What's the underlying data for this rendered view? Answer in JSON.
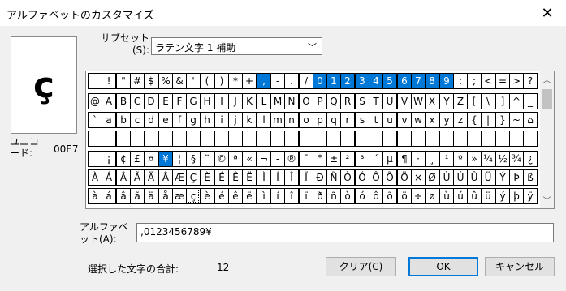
{
  "window": {
    "title": "アルファベットのカスタマイズ",
    "close_glyph": "✕"
  },
  "preview": {
    "char": "ç",
    "unicode_label": "ユニコード:",
    "unicode_value": "00E7"
  },
  "subset": {
    "label": "サブセット(S):",
    "value": "ラテン文字 1 補助",
    "arrow": "﹀"
  },
  "grid": {
    "rows": [
      [
        " ",
        "!",
        "\"",
        "#",
        "$",
        "%",
        "&",
        "'",
        "(",
        ")",
        "*",
        "+",
        ",",
        "-",
        ".",
        "/",
        "0",
        "1",
        "2",
        "3",
        "4",
        "5",
        "6",
        "7",
        "8",
        "9",
        ":",
        ";",
        "<",
        "=",
        ">",
        "?"
      ],
      [
        "@",
        "A",
        "B",
        "C",
        "D",
        "E",
        "F",
        "G",
        "H",
        "I",
        "J",
        "K",
        "L",
        "M",
        "N",
        "O",
        "P",
        "Q",
        "R",
        "S",
        "T",
        "U",
        "V",
        "W",
        "X",
        "Y",
        "Z",
        "[",
        "\\",
        "]",
        "^",
        "_"
      ],
      [
        "`",
        "a",
        "b",
        "c",
        "d",
        "e",
        "f",
        "g",
        "h",
        "i",
        "j",
        "k",
        "l",
        "m",
        "n",
        "o",
        "p",
        "q",
        "r",
        "s",
        "t",
        "u",
        "v",
        "w",
        "x",
        "y",
        "z",
        "{",
        "|",
        "}",
        "~",
        "⌂"
      ],
      [
        "",
        "",
        "",
        "",
        "",
        "",
        "",
        "",
        "",
        "",
        "",
        "",
        "",
        "",
        "",
        "",
        "",
        "",
        "",
        "",
        "",
        "",
        "",
        "",
        "",
        "",
        "",
        "",
        "",
        "",
        "",
        ""
      ],
      [
        " ",
        "¡",
        "¢",
        "£",
        "¤",
        "¥",
        "¦",
        "§",
        "¨",
        "©",
        "ª",
        "«",
        "¬",
        "-",
        "®",
        "¯",
        "°",
        "±",
        "²",
        "³",
        "´",
        "µ",
        "¶",
        "·",
        "¸",
        "¹",
        "º",
        "»",
        "¼",
        "½",
        "¾",
        "¿"
      ],
      [
        "À",
        "Á",
        "Â",
        "Ã",
        "Ä",
        "Å",
        "Æ",
        "Ç",
        "È",
        "É",
        "Ê",
        "Ë",
        "Ì",
        "Í",
        "Î",
        "Ï",
        "Ð",
        "Ñ",
        "Ò",
        "Ó",
        "Ô",
        "Õ",
        "Ö",
        "×",
        "Ø",
        "Ù",
        "Ú",
        "Û",
        "Ü",
        "Ý",
        "Þ",
        "ß"
      ],
      [
        "à",
        "á",
        "â",
        "ã",
        "ä",
        "å",
        "æ",
        "ç",
        "è",
        "é",
        "ê",
        "ë",
        "ì",
        "í",
        "î",
        "ï",
        "ð",
        "ñ",
        "ò",
        "ó",
        "ô",
        "õ",
        "ö",
        "÷",
        "ø",
        "ù",
        "ú",
        "û",
        "ü",
        "ý",
        "þ",
        "ÿ"
      ]
    ],
    "selected": [
      "0-12",
      "0-16",
      "0-17",
      "0-18",
      "0-19",
      "0-20",
      "0-21",
      "0-22",
      "0-23",
      "0-24",
      "0-25",
      "4-5"
    ],
    "focused": "6-7",
    "scroll_up": "︿",
    "scroll_down": "﹀"
  },
  "alphabet": {
    "label": "アルファベット(A):",
    "value": ",0123456789¥"
  },
  "count": {
    "label": "選択した文字の合計:",
    "value": "12"
  },
  "buttons": {
    "clear": "クリア(C)",
    "ok": "OK",
    "cancel": "キャンセル"
  },
  "colors": {
    "selection": "#0078d7",
    "default_button_border": "#0078d7"
  }
}
